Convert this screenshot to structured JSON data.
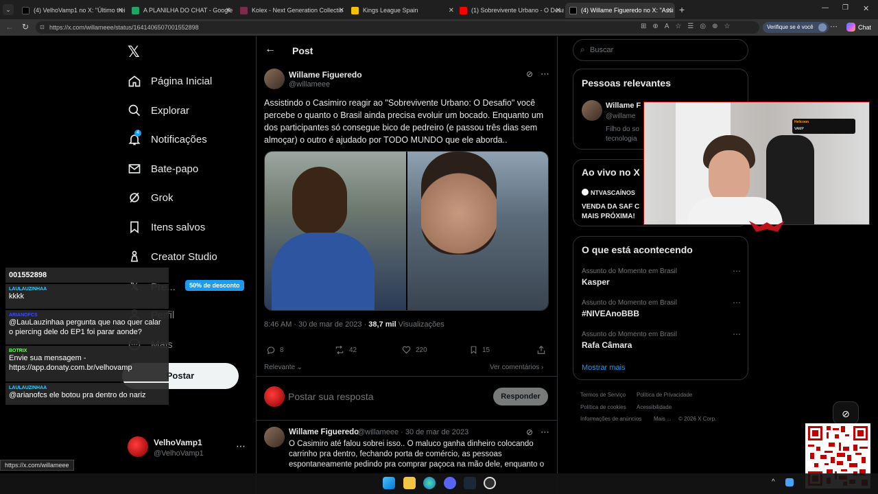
{
  "browser": {
    "tabs": [
      {
        "title": "(4) VelhoVamp1 no X: \"Último trei",
        "color": "#000"
      },
      {
        "title": "A PLANILHA DO CHAT - Google P",
        "color": "#1fa463"
      },
      {
        "title": "Kolex - Next Generation Collectib",
        "color": "#7a2d4a"
      },
      {
        "title": "Kings League Spain",
        "color": "#f2c200"
      },
      {
        "title": "(1) Sobrevivente Urbano - O Desaf",
        "color": "#ff0000"
      },
      {
        "title": "(4) Willame Figueredo no X: \"Assi",
        "color": "#000"
      }
    ],
    "url": "https://x.com/willameee/status/1641406507001552898",
    "verify_label": "Verifique se é você",
    "chat_label": "Chat",
    "status_url": "https://x.com/willameee"
  },
  "nav": {
    "home": "Página Inicial",
    "explore": "Explorar",
    "notifications": "Notificações",
    "notif_badge": "4",
    "messages": "Bate-papo",
    "grok": "Grok",
    "bookmarks": "Itens salvos",
    "creator": "Creator Studio",
    "premium": "Pre...",
    "premium_badge": "50% de desconto",
    "profile": "Perfil",
    "more": "Mais",
    "post_button": "Postar",
    "account_name": "VelhoVamp1",
    "account_handle": "@VelhoVamp1"
  },
  "header": {
    "title": "Post"
  },
  "post": {
    "author": "Willame Figueredo",
    "handle": "@willameee",
    "text": "Assistindo o Casimiro reagir ao \"Sobrevivente Urbano: O Desafio\" você percebe o quanto o Brasil ainda precisa evoluir um bocado. Enquanto um dos participantes só consegue bico de pedreiro (e passou três dias sem almoçar) o outro é ajudado por TODO MUNDO que ele aborda..",
    "time": "8:46 AM · 30 de mar de 2023 · ",
    "views": "38,7 mil",
    "views_label": " Visualizações",
    "replies": "8",
    "reposts": "42",
    "likes": "220",
    "bookmarks": "15",
    "sort_label": "Relevante",
    "view_replies": "Ver comentários",
    "reply_placeholder": "Postar sua resposta",
    "reply_button": "Responder"
  },
  "reply": {
    "author": "Willame Figueredo",
    "meta": "@willameee · 30 de mar de 2023",
    "text": "O Casimiro até falou sobrei isso.. O maluco ganha dinheiro colocando carrinho pra dentro, fechando porta de comércio, as pessoas espontaneamente pedindo pra comprar paçoca na mão dele, enquanto o"
  },
  "sidebar": {
    "search_placeholder": "Buscar",
    "relevant_title": "Pessoas relevantes",
    "relevant_name": "Willame F",
    "relevant_handle": "@willame",
    "relevant_bio1": "Filho do so",
    "relevant_bio2": "tecnologia",
    "live_title": "Ao vivo no X",
    "live_source": "NTVASCAÍNOS",
    "live_text1": "VENDA DA SAF C",
    "live_text2": "MAIS PRÓXIMA!",
    "trending_title": "O que está acontecendo",
    "trends": [
      {
        "label": "Assunto do Momento em Brasil",
        "name": "Kasper"
      },
      {
        "label": "Assunto do Momento em Brasil",
        "name": "#NIVEAnoBBB"
      },
      {
        "label": "Assunto do Momento em Brasil",
        "name": "Rafa Câmara"
      }
    ],
    "show_more": "Mostrar mais",
    "footer": {
      "terms": "Termos de Serviço",
      "privacy": "Política de Privacidade",
      "cookies": "Política de cookies",
      "accessibility": "Acessibilidade",
      "ads": "Informações de anúncios",
      "more": "Mais ...",
      "copyright": "© 2026 X Corp."
    }
  },
  "chat_overlay": [
    {
      "user": "",
      "msg": "001552898",
      "color": "#fff"
    },
    {
      "user": "LAULAUZINHAA",
      "msg": "kkkk",
      "color": "#35d0ff"
    },
    {
      "user": "ARIANOFCS",
      "msg": "@LauLauzinhaa pergunta que nao quer calar o piercing dele do EP1 foi parar aonde?",
      "color": "#3b4dff"
    },
    {
      "user": "BOTRIX",
      "msg": "Envie sua mensagem - https://app.donaty.com.br/velhovamp",
      "color": "#6cff5a"
    },
    {
      "user": "LAULAUZINHAA",
      "msg": "@arianofcs ele botou pra dentro do nariz",
      "color": "#35d0ff"
    }
  ],
  "webcam": {
    "sign_brand": "Helicoon",
    "sign_text": "VAMP"
  }
}
